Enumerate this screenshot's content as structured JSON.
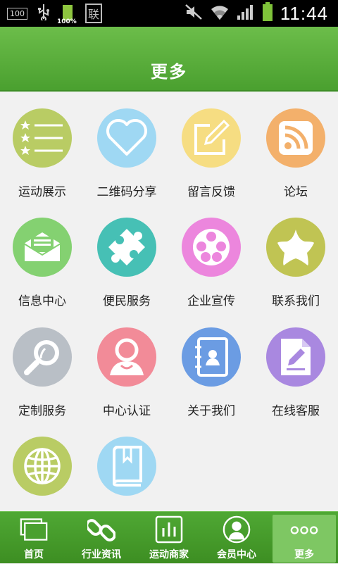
{
  "status_bar": {
    "notification_box": "100",
    "battery_percent": "100%",
    "sim_label": "联",
    "time": "11:44"
  },
  "header": {
    "title": "更多"
  },
  "tiles": [
    {
      "label": "运动展示",
      "icon": "star-list-icon",
      "color": "#b9cc64"
    },
    {
      "label": "二维码分享",
      "icon": "heart-icon",
      "color": "#9fd8f3"
    },
    {
      "label": "留言反馈",
      "icon": "edit-note-icon",
      "color": "#f6dd82"
    },
    {
      "label": "论坛",
      "icon": "rss-icon",
      "color": "#f3b06b"
    },
    {
      "label": "信息中心",
      "icon": "mail-icon",
      "color": "#84d171"
    },
    {
      "label": "便民服务",
      "icon": "puzzle-icon",
      "color": "#46c0b5"
    },
    {
      "label": "企业宣传",
      "icon": "film-reel-icon",
      "color": "#ec86dd"
    },
    {
      "label": "联系我们",
      "icon": "star-icon",
      "color": "#c0c453"
    },
    {
      "label": "定制服务",
      "icon": "magnifier-icon",
      "color": "#b9bfc6"
    },
    {
      "label": "中心认证",
      "icon": "person-icon",
      "color": "#f28b98"
    },
    {
      "label": "关于我们",
      "icon": "contacts-book-icon",
      "color": "#6b9ce3"
    },
    {
      "label": "在线客服",
      "icon": "document-pen-icon",
      "color": "#a988e0"
    },
    {
      "label": "",
      "icon": "globe-icon",
      "color": "#b9cc64"
    },
    {
      "label": "",
      "icon": "book-icon",
      "color": "#9fd8f3"
    }
  ],
  "tabs": [
    {
      "label": "首页",
      "icon": "home-window-icon"
    },
    {
      "label": "行业资讯",
      "icon": "chain-link-icon"
    },
    {
      "label": "运动商家",
      "icon": "bar-graph-icon"
    },
    {
      "label": "会员中心",
      "icon": "user-avatar-icon"
    },
    {
      "label": "更多",
      "icon": "more-dots-icon",
      "active": true
    }
  ]
}
